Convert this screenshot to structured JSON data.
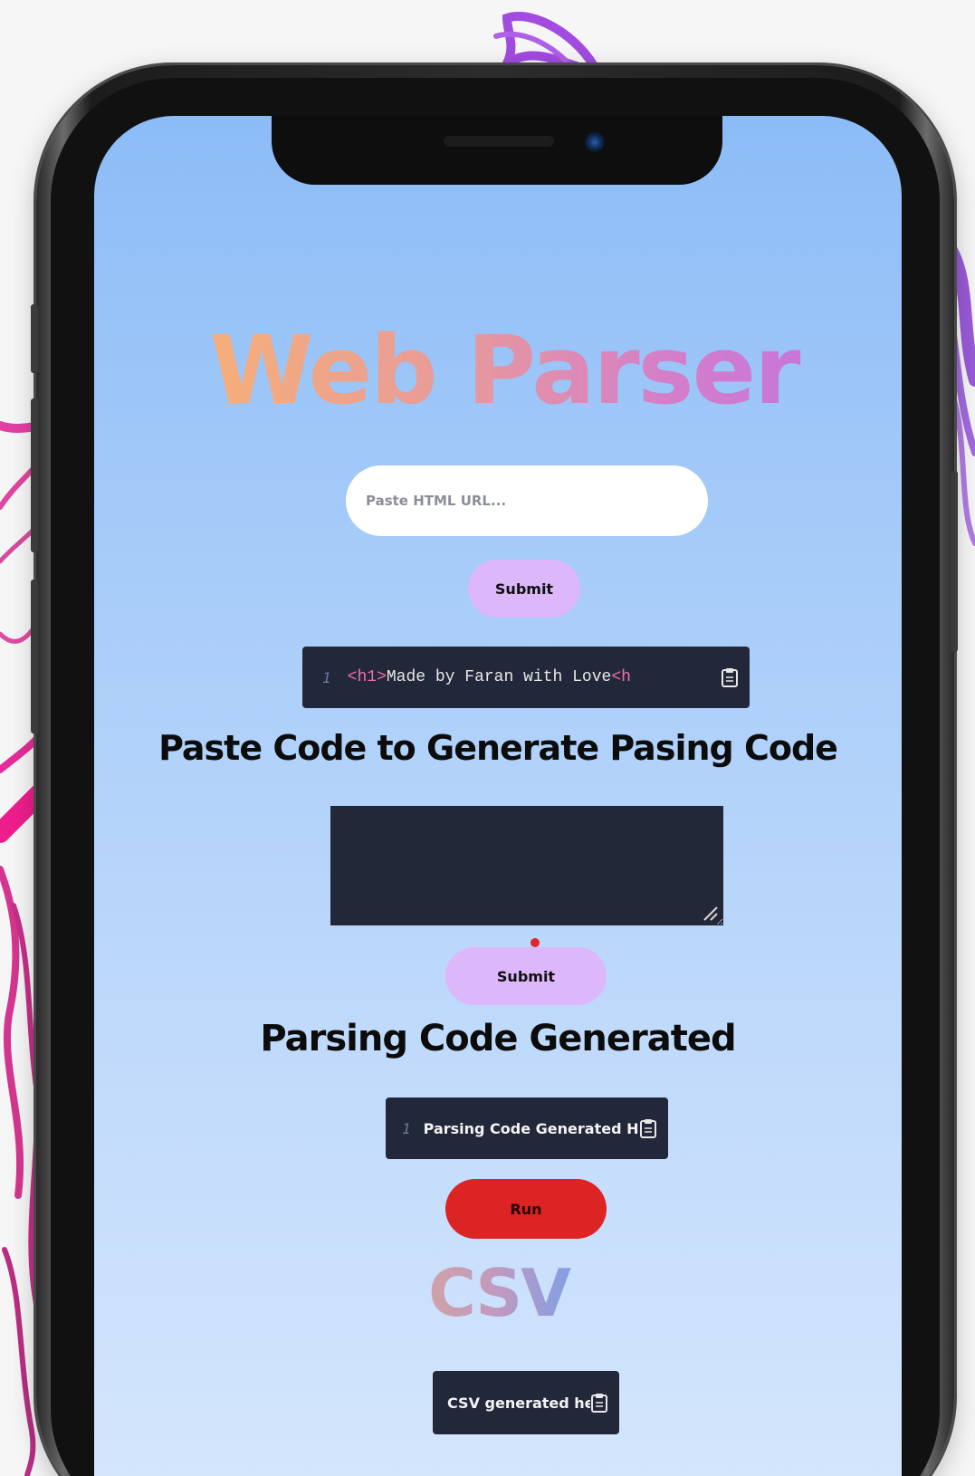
{
  "app": {
    "title": "Web Parser"
  },
  "url_form": {
    "placeholder": "Paste HTML URL...",
    "submit_label": "Submit"
  },
  "html_output": {
    "line_number": "1",
    "tag_open": "<h1>",
    "text": "Made by Faran with Love",
    "tag_close": "<h"
  },
  "code_section": {
    "heading": "Paste Code to Generate Pasing Code",
    "textarea_value": "",
    "submit_label": "Submit"
  },
  "parsing_section": {
    "heading": "Parsing Code Generated",
    "line_number": "1",
    "output_text": "Parsing Code Generated He",
    "run_label": "Run"
  },
  "csv_section": {
    "heading": "CSV",
    "output_text": "CSV generated he"
  },
  "icons": {
    "copy": "clipboard-icon",
    "resize": "resize-handle-icon"
  },
  "colors": {
    "submit_bg": "#dcb8fb",
    "run_bg": "#dc2424",
    "code_bg": "#22283a",
    "screen_top": "#8cbcf7",
    "screen_bottom": "#d4e6fc"
  }
}
